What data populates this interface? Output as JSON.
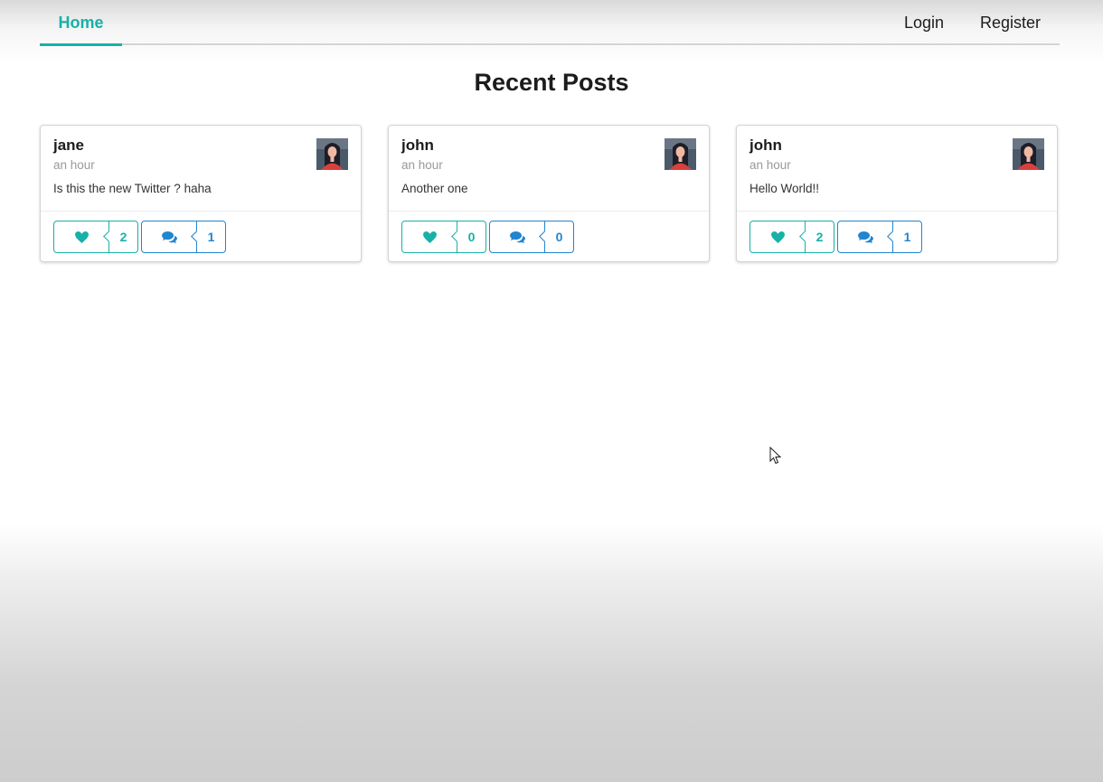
{
  "nav": {
    "home": "Home",
    "login": "Login",
    "register": "Register"
  },
  "page": {
    "title": "Recent Posts"
  },
  "colors": {
    "accent_teal": "#17b1a8",
    "accent_blue": "#2185d0"
  },
  "icons": {
    "like": "heart-icon",
    "comment": "comments-icon"
  },
  "posts": [
    {
      "author": "jane",
      "time": "an hour",
      "body": "Is this the new Twitter ? haha",
      "likes": "2",
      "comments": "1"
    },
    {
      "author": "john",
      "time": "an hour",
      "body": "Another one",
      "likes": "0",
      "comments": "0"
    },
    {
      "author": "john",
      "time": "an hour",
      "body": "Hello World!!",
      "likes": "2",
      "comments": "1"
    }
  ]
}
